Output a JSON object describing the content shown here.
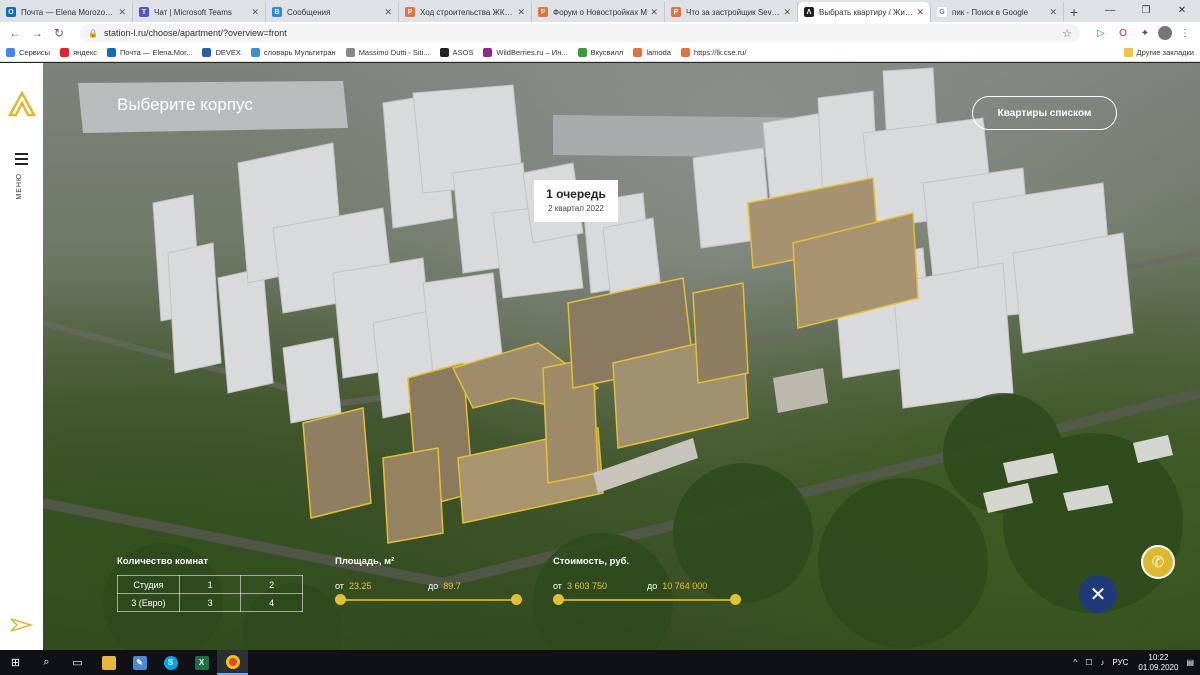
{
  "browser": {
    "tabs": [
      {
        "title": "Почта — Elena Morozova –",
        "color": "#0f6cbd",
        "letter": "O"
      },
      {
        "title": "Чат | Microsoft Teams",
        "color": "#5059c9",
        "letter": "T"
      },
      {
        "title": "Сообщения",
        "color": "#2787f5",
        "letter": "В"
      },
      {
        "title": "Ход строительства ЖК «Л",
        "color": "#e8703a",
        "letter": "Р"
      },
      {
        "title": "Форум о Новостройках М",
        "color": "#e8703a",
        "letter": "Р"
      },
      {
        "title": "Что за застройщик Seven",
        "color": "#e8703a",
        "letter": "Р"
      },
      {
        "title": "Выбрать квартиру / Жило",
        "color": "#222222",
        "letter": "Λ"
      },
      {
        "title": "пик - Поиск в Google",
        "color": "#ffffff",
        "letter": "G"
      }
    ],
    "new_tab": "+",
    "url": "station-l.ru/choose/apartment/?overview=front",
    "bookmarks": [
      "Сервисы",
      "яндекс",
      "Почта — Elena.Mor...",
      "DEVEX",
      "словарь Мультитран",
      "Massimo Dutti - Siti...",
      "ASOS",
      "WildBerries.ru – Ин...",
      "Вкусвилл",
      "lamoda",
      "https://lk.cse.ru/"
    ],
    "other_bookmarks": "Другие закладки"
  },
  "site": {
    "menu_label": "МЕНЮ",
    "title": "Выберите корпус",
    "list_button": "Квартиры списком",
    "tooltip": {
      "title": "1 очередь",
      "subtitle": "2 квартал 2022"
    },
    "filters": {
      "rooms_title": "Количество комнат",
      "rooms": [
        [
          "Студия",
          "1",
          "2"
        ],
        [
          "3 (Евро)",
          "3",
          "4"
        ]
      ],
      "area": {
        "title": "Площадь, м²",
        "from_label": "от",
        "from": "23.25",
        "to_label": "до",
        "to": "89.7"
      },
      "price": {
        "title": "Стоимость, руб.",
        "from_label": "от",
        "from": "3 603 750",
        "to_label": "до",
        "to": "10 764 000"
      }
    }
  },
  "taskbar": {
    "lang": "РУС",
    "time": "10:22",
    "date": "01.09.2020"
  }
}
